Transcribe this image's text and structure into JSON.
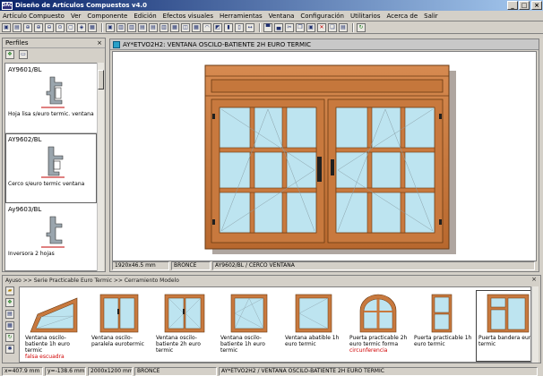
{
  "window": {
    "title": "Diseño de Artículos Compuestos v4.0",
    "app_icon_text": "DAC",
    "controls": [
      "_",
      "□",
      "×"
    ]
  },
  "menu": [
    "Artículo Compuesto",
    "Ver",
    "Componente",
    "Edición",
    "Efectos visuales",
    "Herramientas",
    "Ventana",
    "Configuración",
    "Utilitarios",
    "Acerca de",
    "Salir"
  ],
  "perfiles": {
    "title": "Perfiles",
    "close": "×",
    "items": [
      {
        "code": "AY9601/BL",
        "desc": "Hoja lisa s/euro termic. ventana"
      },
      {
        "code": "AY9602/BL",
        "desc": "Cerco s/euro termic ventana"
      },
      {
        "code": "Ay9603/BL",
        "desc": "Inversora 2 hojas"
      }
    ]
  },
  "doc": {
    "title": "AY*ETVO2H2: VENTANA OSCILO-BATIENTE 2H EURO TERMIC",
    "status": [
      "1920x46.5 mm",
      "BRONCE",
      "AY9602/BL / CERCO VENTANA"
    ]
  },
  "bottom": {
    "breadcrumb": "Ayuso >> Serie Practicable Euro Termic >> Cerramiento Modelo",
    "close": "×",
    "items": [
      {
        "label": "Ventana oscilo-batiente 1h euro termic",
        "note": "falsa escuadra"
      },
      {
        "label": "Ventana oscilo-paralela eurotermic",
        "note": ""
      },
      {
        "label": "Ventana oscilo-batiente 2h euro termic",
        "note": ""
      },
      {
        "label": "Ventana oscilo-batiente 1h euro termic",
        "note": ""
      },
      {
        "label": "Ventana abatible 1h euro termic",
        "note": ""
      },
      {
        "label": "Puerta practicable 2h euro termic forma",
        "note": "circunferencia"
      },
      {
        "label": "Puerta practicable 1h euro termic",
        "note": ""
      },
      {
        "label": "Puerta bandera euro termic",
        "note": ""
      }
    ]
  },
  "statusbar": [
    "x=407.9 mm",
    "y=-138.6 mm",
    "2000x1200 mm",
    "BRONCE",
    "AY*ETVO2H2 / VENTANA OSCILO-BATIENTE 2H EURO TERMIC"
  ],
  "colors": {
    "frame": "#c87941",
    "frame_dark": "#8a4a1c",
    "glass": "#bde4f0",
    "title_bar": "#0a246a"
  }
}
